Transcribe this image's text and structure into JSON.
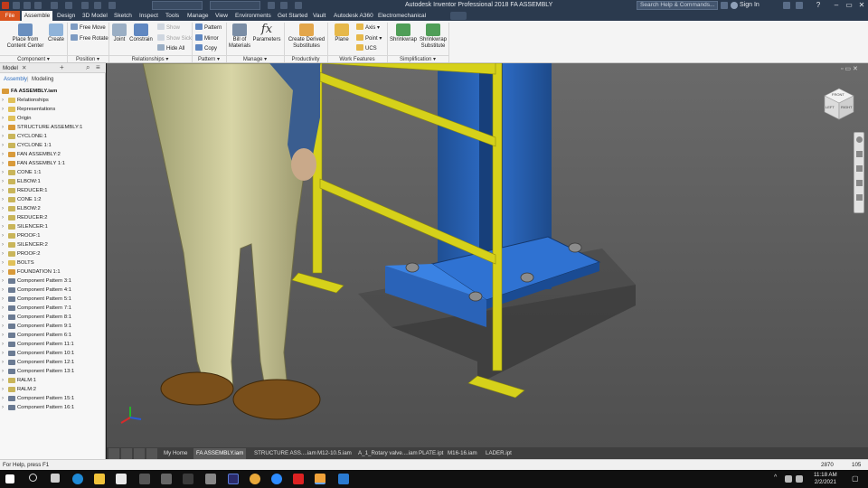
{
  "title_bar": {
    "app_title": "Autodesk Inventor Professional 2018   FA ASSEMBLY",
    "search_placeholder": "Search Help & Commands...",
    "sign_in": "Sign In",
    "help": "?",
    "minimize": "–",
    "maximize": "▭",
    "close": "✕"
  },
  "ribbon_tabs": [
    "File",
    "Assemble",
    "Design",
    "3D Model",
    "Sketch",
    "Inspect",
    "Tools",
    "Manage",
    "View",
    "Environments",
    "Get Started",
    "Vault",
    "Autodesk A360",
    "Electromechanical"
  ],
  "ribbon": {
    "component": {
      "place": "Place from\nContent Center",
      "create": "Create",
      "group": "Component ▾"
    },
    "position": {
      "free_move": "Free Move",
      "free_rotate": "Free Rotate",
      "group": "Position ▾"
    },
    "relationships": {
      "joint": "Joint",
      "constrain": "Constrain",
      "show": "Show",
      "show_sick": "Show Sick",
      "hide_all": "Hide All",
      "group": "Relationships ▾"
    },
    "pattern": {
      "pattern": "Pattern",
      "mirror": "Mirror",
      "copy": "Copy",
      "group": "Pattern ▾"
    },
    "manage": {
      "bom": "Bill of\nMaterials",
      "parameters": "Parameters",
      "group": "Manage ▾"
    },
    "productivity": {
      "create_derived": "Create Derived\nSubstitutes",
      "group": "Productivity"
    },
    "work_features": {
      "plane": "Plane",
      "axis": "Axis ▾",
      "point": "Point ▾",
      "ucs": "UCS",
      "group": "Work Features"
    },
    "simplification": {
      "shrinkwrap": "Shrinkwrap",
      "shrinkwrap_sub": "Shrinkwrap\nSubstitute",
      "group": "Simplification ▾"
    }
  },
  "browser": {
    "tab_label": "Model",
    "close": "✕",
    "add": "+",
    "search_icon": "⌕",
    "menu_icon": "≡",
    "sub_assembly": "Assembly",
    "sub_modeling": "Modeling",
    "sub_sep": "|",
    "root": "FA ASSEMBLY.iam",
    "nodes": [
      "Relationships",
      "Representations",
      "Origin",
      "STRUCTURE ASSEMBLY:1",
      "CYCLONE:1",
      "CYCLONE 1:1",
      "FAN ASSEMBLY:2",
      "FAN ASSEMBLY 1:1",
      "CONE 1:1",
      "ELBOW:1",
      "REDUCER:1",
      "CONE 1:2",
      "ELBOW:2",
      "REDUCER:2",
      "SILENCER:1",
      "PROOF:1",
      "SILENCER:2",
      "PROOF:2",
      "BOLTS",
      "FOUNDATION 1:1",
      "Component Pattern 3:1",
      "Component Pattern 4:1",
      "Component Pattern 5:1",
      "Component Pattern 7:1",
      "Component Pattern 8:1",
      "Component Pattern 9:1",
      "Component Pattern 6:1",
      "Component Pattern 11:1",
      "Component Pattern 10:1",
      "Component Pattern 12:1",
      "Component Pattern 13:1",
      "RALM:1",
      "RALM:2",
      "Component Pattern 15:1",
      "Component Pattern 16:1"
    ]
  },
  "viewcube": {
    "front": "FRONT",
    "left": "LEFT",
    "right": "RIGHT"
  },
  "doc_tabs": {
    "home": "My Home",
    "active": "FA ASSEMBLY.iam",
    "others": [
      "STRUCTURE ASS....iam",
      "M12-10.5.iam",
      "A_1_Rotary valve....iam",
      "PLATE.ipt",
      "M16-16.iam",
      "LADER.ipt"
    ]
  },
  "status": {
    "help_text": "For Help, press F1",
    "count1": "2870",
    "count2": "105"
  },
  "taskbar": {
    "time": "11:18 AM",
    "date": "2/2/2021",
    "up": "^",
    "notify": "▢"
  },
  "colors": {
    "accent_file": "#d9531e",
    "title_bar": "#2b3a4e",
    "viewport": "#5e5e5e",
    "rail_yellow": "#d6d11a",
    "column_blue": "#2c6cc4"
  }
}
